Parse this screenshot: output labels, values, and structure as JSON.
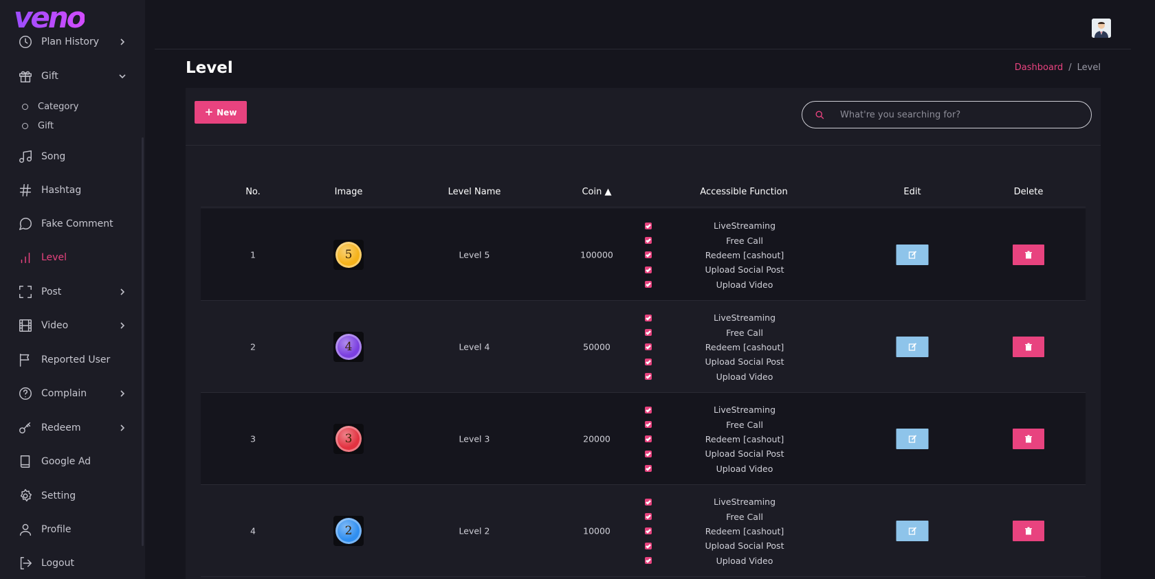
{
  "brand": {
    "logo_text": "veno"
  },
  "sidebar": {
    "items": [
      {
        "label": "Plan History",
        "icon": "clock-icon",
        "chevron": "right"
      },
      {
        "label": "Gift",
        "icon": "gift-icon",
        "chevron": "down"
      },
      {
        "label": "Song",
        "icon": "music-icon"
      },
      {
        "label": "Hashtag",
        "icon": "hashtag-icon"
      },
      {
        "label": "Fake Comment",
        "icon": "comment-icon"
      },
      {
        "label": "Level",
        "icon": "bar-chart-icon",
        "active": true
      },
      {
        "label": "Post",
        "icon": "frame-icon",
        "chevron": "right"
      },
      {
        "label": "Video",
        "icon": "film-icon",
        "chevron": "right"
      },
      {
        "label": "Reported User",
        "icon": "flag-icon"
      },
      {
        "label": "Complain",
        "icon": "help-circle-icon",
        "chevron": "right"
      },
      {
        "label": "Redeem",
        "icon": "key-icon",
        "chevron": "right"
      },
      {
        "label": "Google Ad",
        "icon": "book-icon"
      },
      {
        "label": "Setting",
        "icon": "gear-icon"
      },
      {
        "label": "Profile",
        "icon": "user-icon"
      },
      {
        "label": "Logout",
        "icon": "logout-icon"
      }
    ],
    "gift_sub": [
      "Category",
      "Gift"
    ]
  },
  "header": {
    "title": "Level",
    "breadcrumb": {
      "home": "Dashboard",
      "separator": "/",
      "current": "Level"
    }
  },
  "toolbar": {
    "new_label": "New",
    "search_placeholder": "What're you searching for?"
  },
  "table": {
    "columns": [
      "No.",
      "Image",
      "Level Name",
      "Coin",
      "Accessible Function",
      "Edit",
      "Delete"
    ],
    "sort_indicator": "▲",
    "rows": [
      {
        "no": "1",
        "badge": "5",
        "badge_color": "#f5b21a",
        "name": "Level 5",
        "coin": "100000",
        "functions": [
          "LiveStreaming",
          "Free Call",
          "Redeem [cashout]",
          "Upload Social Post",
          "Upload Video"
        ]
      },
      {
        "no": "2",
        "badge": "4",
        "badge_color": "#7b3fe0",
        "name": "Level 4",
        "coin": "50000",
        "functions": [
          "LiveStreaming",
          "Free Call",
          "Redeem [cashout]",
          "Upload Social Post",
          "Upload Video"
        ]
      },
      {
        "no": "3",
        "badge": "3",
        "badge_color": "#e23240",
        "name": "Level 3",
        "coin": "20000",
        "functions": [
          "LiveStreaming",
          "Free Call",
          "Redeem [cashout]",
          "Upload Social Post",
          "Upload Video"
        ]
      },
      {
        "no": "4",
        "badge": "2",
        "badge_color": "#2f8ef0",
        "name": "Level 2",
        "coin": "10000",
        "functions": [
          "LiveStreaming",
          "Free Call",
          "Redeem [cashout]",
          "Upload Social Post",
          "Upload Video"
        ]
      }
    ]
  },
  "colors": {
    "accent": "#e8437f",
    "edit": "#8ec4ea",
    "bg": "#15151d",
    "panel": "#1c1c25"
  }
}
